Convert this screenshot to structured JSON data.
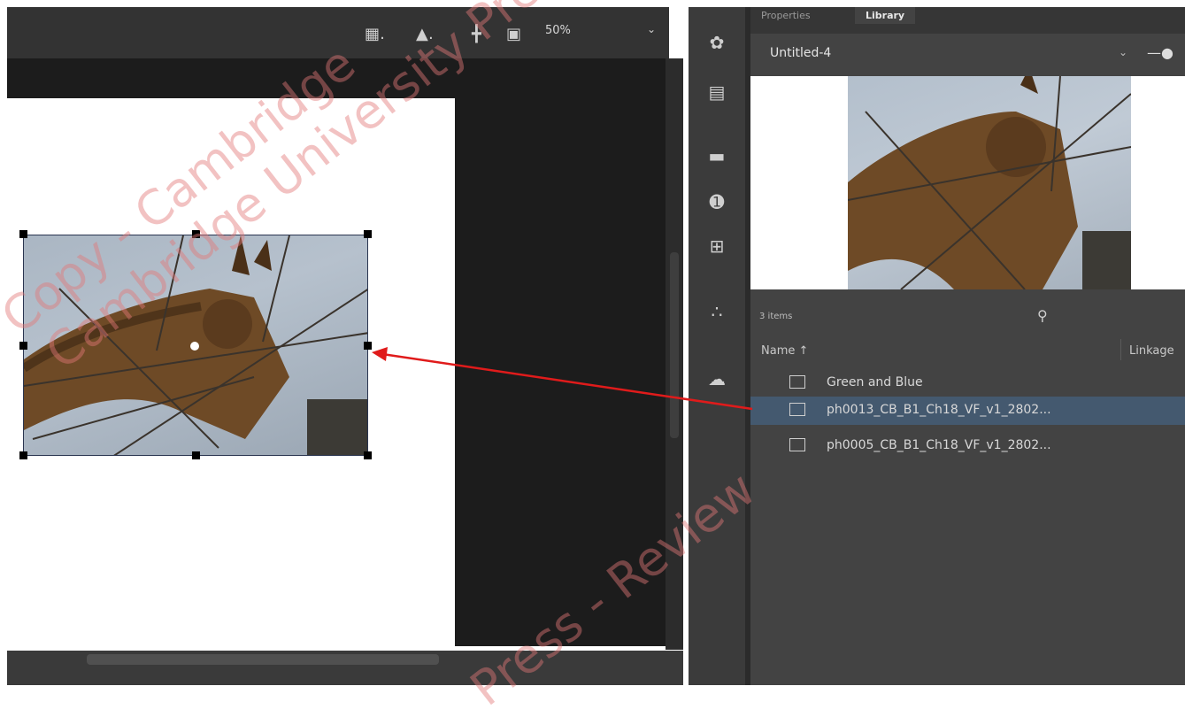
{
  "toolbar": {
    "zoom_level": "50%",
    "icons": [
      "layer-comp-icon",
      "fill-bucket-icon",
      "align-icon",
      "frame-icon",
      "chevron-down-icon"
    ]
  },
  "side_icons": [
    "clone-stamp-icon",
    "layers-icon",
    "adjust-icon",
    "info-icon",
    "transform-icon",
    "scatter-icon",
    "creative-cloud-icon"
  ],
  "panel": {
    "tabs": [
      {
        "label": "Properties",
        "active": false
      },
      {
        "label": "Library",
        "active": true
      }
    ],
    "document_name": "Untitled-4",
    "items_count": "3 items",
    "columns": {
      "name": "Name",
      "linkage": "Linkage"
    },
    "items": [
      {
        "label": "Green and Blue",
        "icon": "color-swatch-icon",
        "selected": false
      },
      {
        "label": "ph0013_CB_B1_Ch18_VF_v1_2802...",
        "icon": "image-icon",
        "selected": true
      },
      {
        "label": "ph0005_CB_B1_Ch18_VF_v1_2802...",
        "icon": "image-icon",
        "selected": false
      }
    ]
  },
  "watermark": {
    "lines": [
      "Cambridge University Press - Review Copy",
      "Copy - Cambridge",
      "Press - Review"
    ]
  },
  "colors": {
    "arrow": "#e01b1b",
    "selection_row": "#44596f",
    "panel_bg": "#434343",
    "canvas_bg": "#1c1c1c"
  }
}
